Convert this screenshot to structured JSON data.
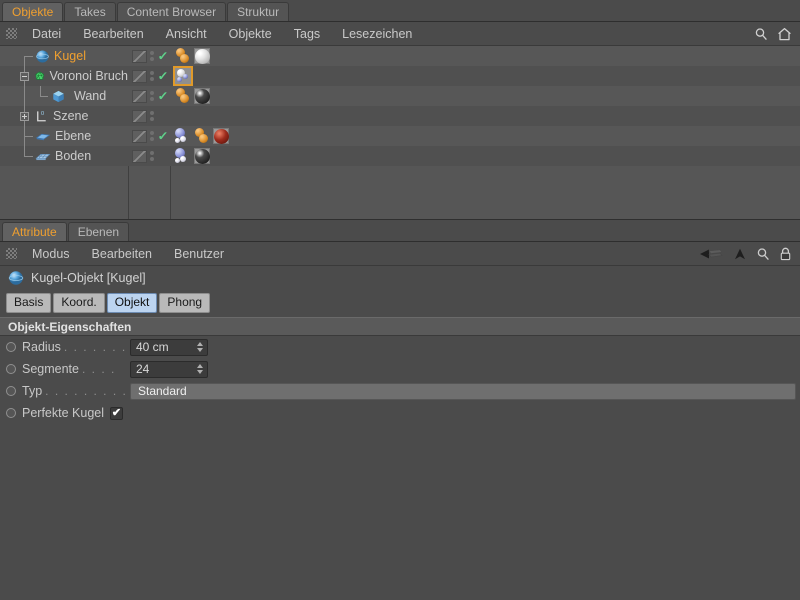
{
  "object_manager": {
    "tabs": [
      {
        "label": "Objekte",
        "active": true
      },
      {
        "label": "Takes",
        "active": false
      },
      {
        "label": "Content Browser",
        "active": false
      },
      {
        "label": "Struktur",
        "active": false
      }
    ],
    "menu": [
      "Datei",
      "Bearbeiten",
      "Ansicht",
      "Objekte",
      "Tags",
      "Lesezeichen"
    ],
    "toolbar_icons": [
      "search-icon",
      "home-icon"
    ],
    "rows": [
      {
        "name": "Kugel",
        "icon": "sphere-object-icon",
        "selected": true,
        "depth": 0,
        "expander": "none",
        "visible_check": true,
        "tags": [
          "material-orange-tag",
          "material-white-sphere-tag"
        ]
      },
      {
        "name": "Voronoi Bruch",
        "icon": "voronoi-fracture-icon",
        "selected": false,
        "depth": 0,
        "expander": "minus",
        "visible_check": true,
        "tags": [
          "voronoi-selected-tag"
        ]
      },
      {
        "name": "Wand",
        "icon": "cube-object-icon",
        "selected": false,
        "depth": 1,
        "expander": "none",
        "visible_check": true,
        "tags": [
          "material-orange-tag",
          "material-black-sphere-tag"
        ]
      },
      {
        "name": "Szene",
        "icon": "scene-axis-icon",
        "selected": false,
        "depth": 0,
        "expander": "plus",
        "visible_check": false,
        "tags": []
      },
      {
        "name": "Ebene",
        "icon": "plane-object-icon",
        "selected": false,
        "depth": 0,
        "expander": "none",
        "visible_check": true,
        "tags": [
          "dynamics-tag",
          "material-orange-tag",
          "material-red-sphere-tag"
        ]
      },
      {
        "name": "Boden",
        "icon": "floor-grid-icon",
        "selected": false,
        "depth": 0,
        "expander": "none",
        "visible_check": false,
        "tags": [
          "dynamics-tag",
          "material-black-sphere-tag"
        ]
      }
    ]
  },
  "attribute_manager": {
    "tabs": [
      {
        "label": "Attribute",
        "active": true
      },
      {
        "label": "Ebenen",
        "active": false
      }
    ],
    "menu": [
      "Modus",
      "Bearbeiten",
      "Benutzer"
    ],
    "toolbar_icons": [
      "back-arrow-icon",
      "up-arrow-icon",
      "search-icon",
      "lock-icon"
    ],
    "object_title": "Kugel-Objekt [Kugel]",
    "object_icon": "sphere-object-icon",
    "mode_tabs": [
      {
        "label": "Basis",
        "active": false
      },
      {
        "label": "Koord.",
        "active": false
      },
      {
        "label": "Objekt",
        "active": true
      },
      {
        "label": "Phong",
        "active": false
      }
    ],
    "section_title": "Objekt-Eigenschaften",
    "properties": [
      {
        "label": "Radius",
        "dots": ". . . . . . .",
        "type": "number",
        "value": "40 cm"
      },
      {
        "label": "Segmente",
        "dots": ". . . .",
        "type": "number",
        "value": "24"
      },
      {
        "label": "Typ",
        "dots": ". . . . . . . . . . .",
        "type": "select",
        "value": "Standard"
      },
      {
        "label": "Perfekte Kugel",
        "dots": "",
        "type": "checkbox",
        "value": "✔"
      }
    ]
  },
  "colors": {
    "accent_orange": "#f0a030",
    "tab_active_text": "#f0a030",
    "panel_bg": "#4b4b4b",
    "row_bg_odd": "#575757",
    "row_bg_even": "#505050",
    "check_green": "#5fd18a",
    "active_mode_tab": "#bcd4f0"
  }
}
